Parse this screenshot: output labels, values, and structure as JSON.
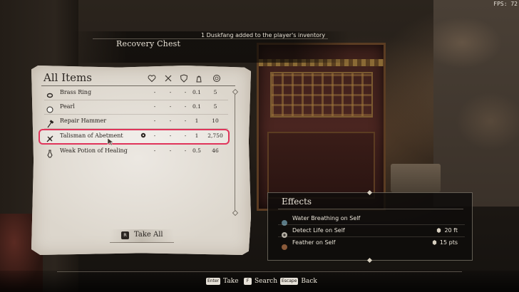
{
  "hud": {
    "fps": "FPS: 72"
  },
  "header": {
    "title": "Recovery Chest",
    "notification": "1 Duskfang added to the player's inventory"
  },
  "inventory": {
    "title": "All Items",
    "columns": [
      "heart-icon",
      "crossed-swords-icon",
      "shield-icon",
      "weight-icon",
      "coin-icon"
    ],
    "items": [
      {
        "name": "Brass Ring",
        "icon": "ring-icon",
        "stat1": "-",
        "stat2": "-",
        "stat3": "-",
        "weight": "0.1",
        "value": "5",
        "selected": false
      },
      {
        "name": "Pearl",
        "icon": "pearl-icon",
        "stat1": "-",
        "stat2": "-",
        "stat3": "-",
        "weight": "0.1",
        "value": "5",
        "selected": false
      },
      {
        "name": "Repair Hammer",
        "icon": "hammer-icon",
        "stat1": "-",
        "stat2": "-",
        "stat3": "-",
        "weight": "1",
        "value": "10",
        "selected": false
      },
      {
        "name": "Talisman of Abetment",
        "icon": "talisman-icon",
        "stat1": "-",
        "stat2": "-",
        "stat3": "-",
        "weight": "1",
        "value": "2,750",
        "selected": true
      },
      {
        "name": "Weak Potion of Healing",
        "icon": "potion-icon",
        "stat1": "-",
        "stat2": "-",
        "stat3": "-",
        "weight": "0.5",
        "value": "46",
        "selected": false
      }
    ],
    "take_all": {
      "key": "R",
      "label": "Take All"
    }
  },
  "effects": {
    "title": "Effects",
    "items": [
      {
        "name": "Water Breathing on Self",
        "magnitude": ""
      },
      {
        "name": "Detect Life on Self",
        "magnitude": "20 ft"
      },
      {
        "name": "Feather on Self",
        "magnitude": "15 pts"
      }
    ]
  },
  "hints": [
    {
      "key": "Enter",
      "label": "Take"
    },
    {
      "key": "F",
      "label": "Search"
    },
    {
      "key": "Escape",
      "label": "Back"
    }
  ],
  "colors": {
    "selection": "#e0345a",
    "parchment": "#ddd7cd",
    "ink": "#2a2521"
  }
}
